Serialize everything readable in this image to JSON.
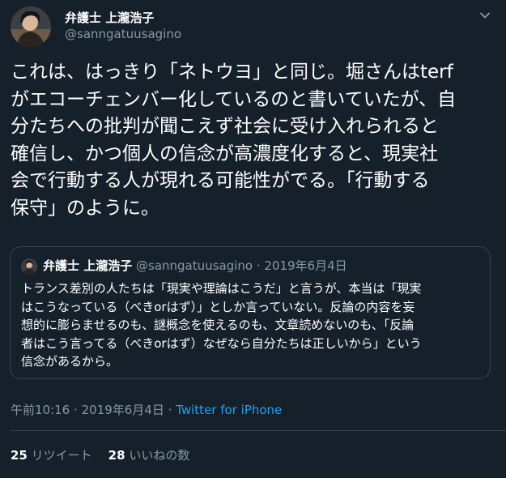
{
  "author": {
    "display_name": "弁護士 上瀧浩子",
    "handle": "@sanngatuusagino"
  },
  "tweet": {
    "lines": [
      "これは、はっきり「ネトウヨ」と同じ。堀さんはterf",
      "がエコーチェンバー化しているのと書いていたが、自",
      "分たちへの批判が聞こえず社会に受け入れられると",
      "確信し、かつ個人の信念が高濃度化すると、現実社",
      "会で行動する人が現れる可能性がでる。「行動する",
      "保守」のように。"
    ]
  },
  "quoted_tweet": {
    "display_name": "弁護士 上瀧浩子",
    "handle": "@sanngatuusagino",
    "separator": "·",
    "date": "2019年6月4日",
    "lines": [
      "トランス差別の人たちは「現実や理論はこうだ」と言うが、本当は「現実",
      "はこうなっている（べきorはず）」としか言っていない。反論の内容を妄",
      "想的に膨らませるのも、謎概念を使えるのも、文章読めないのも、「反論",
      "者はこう言ってる（べきorはず）なぜなら自分たちは正しいから」という",
      "信念があるから。"
    ]
  },
  "meta": {
    "time": "午前10:16",
    "separator": "·",
    "date": "2019年6月4日",
    "source": "Twitter for iPhone"
  },
  "stats": {
    "retweets_count": "25",
    "retweets_label": "リツイート",
    "likes_count": "28",
    "likes_label": "いいねの数"
  },
  "colors": {
    "background": "#15202b",
    "text": "#ffffff",
    "muted": "#8899a6",
    "link": "#1da1f2",
    "border": "#38444d"
  },
  "icons": {
    "menu": "chevron-down-icon"
  }
}
